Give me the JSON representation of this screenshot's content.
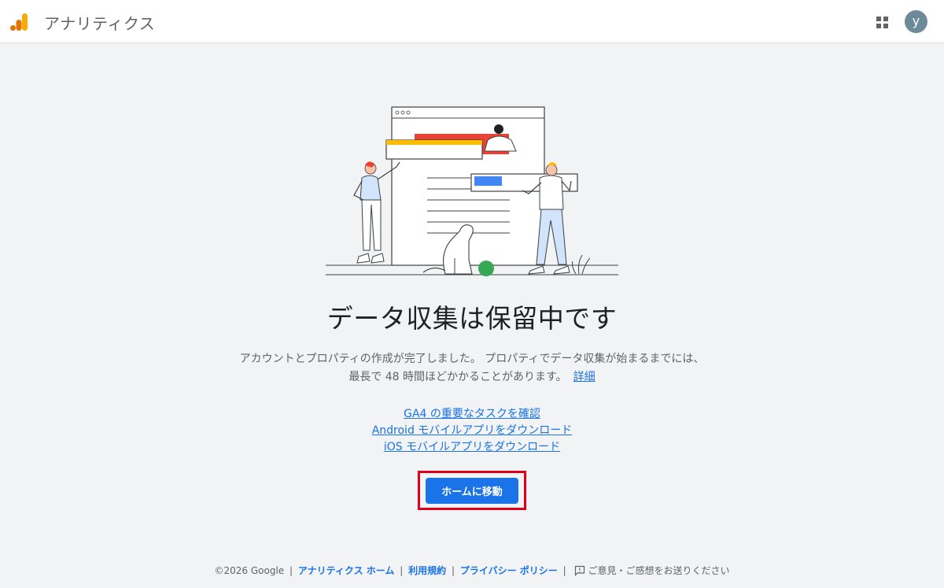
{
  "header": {
    "app_title": "アナリティクス",
    "avatar_letter": "y",
    "brand_colors": [
      "#f9ab00",
      "#e37400"
    ]
  },
  "main": {
    "headline": "データ収集は保留中です",
    "description_line1": "アカウントとプロパティの作成が完了しました。 プロパティでデータ収集が始まるまでには、",
    "description_line2": "最長で 48 時間ほどかかることがあります。",
    "learn_more_link": "詳細",
    "links": [
      "GA4 の重要なタスクを確認",
      "Android モバイルアプリをダウンロード",
      "iOS モバイルアプリをダウンロード"
    ],
    "home_button_label": "ホームに移動",
    "accent_color": "#1a73e8",
    "highlight_color": "#e1001c"
  },
  "footer": {
    "copyright": "©2026 Google",
    "separator": "|",
    "analytics_home": "アナリティクス ホーム",
    "terms": "利用規約",
    "privacy": "プライバシー ポリシー",
    "feedback": "ご意見・ご感想をお送りください"
  },
  "icons": {
    "apps": "apps-grid-icon",
    "feedback": "feedback-icon",
    "logo": "analytics-logo-icon"
  }
}
